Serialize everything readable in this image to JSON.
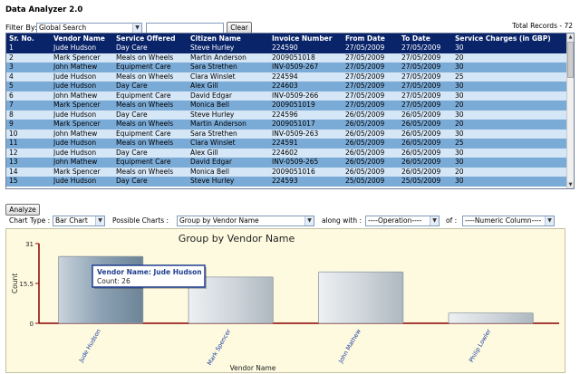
{
  "app": {
    "title": "Data Analyzer 2.0"
  },
  "filter": {
    "label": "Filter By:",
    "select_value": "Global Search",
    "search_value": "",
    "clear_label": "Clear",
    "total_records": "Total Records - 72"
  },
  "grid": {
    "columns": [
      "Sr. No.",
      "Vendor Name",
      "Service Offered",
      "Citizen Name",
      "Invoice Number",
      "From Date",
      "To Date",
      "Service Charges (in GBP)"
    ],
    "rows": [
      [
        "1",
        "Jude Hudson",
        "Day Care",
        "Steve Hurley",
        "224590",
        "27/05/2009",
        "27/05/2009",
        "30"
      ],
      [
        "2",
        "Mark Spencer",
        "Meals on Wheels",
        "Martin Anderson",
        "2009051018",
        "27/05/2009",
        "27/05/2009",
        "20"
      ],
      [
        "3",
        "John Mathew",
        "Equipment Care",
        "Sara Strethen",
        "INV-0509-267",
        "27/05/2009",
        "27/05/2009",
        "30"
      ],
      [
        "4",
        "Jude Hudson",
        "Meals on Wheels",
        "Clara Winslet",
        "224594",
        "27/05/2009",
        "27/05/2009",
        "25"
      ],
      [
        "5",
        "Jude Hudson",
        "Day Care",
        "Alex Gill",
        "224603",
        "27/05/2009",
        "27/05/2009",
        "30"
      ],
      [
        "6",
        "John Mathew",
        "Equipment Care",
        "David Edgar",
        "INV-0509-266",
        "27/05/2009",
        "27/05/2009",
        "30"
      ],
      [
        "7",
        "Mark Spencer",
        "Meals on Wheels",
        "Monica Bell",
        "2009051019",
        "27/05/2009",
        "27/05/2009",
        "20"
      ],
      [
        "8",
        "Jude Hudson",
        "Day Care",
        "Steve Hurley",
        "224596",
        "26/05/2009",
        "26/05/2009",
        "30"
      ],
      [
        "9",
        "Mark Spencer",
        "Meals on Wheels",
        "Martin Anderson",
        "2009051017",
        "26/05/2009",
        "26/05/2009",
        "20"
      ],
      [
        "10",
        "John Mathew",
        "Equipment Care",
        "Sara Strethen",
        "INV-0509-263",
        "26/05/2009",
        "26/05/2009",
        "30"
      ],
      [
        "11",
        "Jude Hudson",
        "Meals on Wheels",
        "Clara Winslet",
        "224591",
        "26/05/2009",
        "26/05/2009",
        "25"
      ],
      [
        "12",
        "Jude Hudson",
        "Day Care",
        "Alex Gill",
        "224602",
        "26/05/2009",
        "26/05/2009",
        "30"
      ],
      [
        "13",
        "John Mathew",
        "Equipment Care",
        "David Edgar",
        "INV-0509-265",
        "26/05/2009",
        "26/05/2009",
        "30"
      ],
      [
        "14",
        "Mark Spencer",
        "Meals on Wheels",
        "Monica Bell",
        "2009051016",
        "26/05/2009",
        "26/05/2009",
        "20"
      ],
      [
        "15",
        "Jude Hudson",
        "Day Care",
        "Steve Hurley",
        "224593",
        "25/05/2009",
        "25/05/2009",
        "30"
      ]
    ],
    "selected_row_index": 0
  },
  "analyze": {
    "button_label": "Analyze"
  },
  "chart_controls": {
    "chart_type_label": "Chart Type :",
    "chart_type_value": "Bar Chart",
    "possible_charts_label": "Possible Charts :",
    "possible_charts_value": "Group by Vendor Name",
    "along_with_label": "along with :",
    "operation_value": "----Operation----",
    "of_label": "of :",
    "numeric_column_value": "----Numeric Column----"
  },
  "tooltip": {
    "title": "Vendor Name: Jude Hudson",
    "value": "Count: 26"
  },
  "chart_data": {
    "type": "bar",
    "title": "Group by Vendor Name",
    "xlabel": "Vendor Name",
    "ylabel": "Count",
    "categories": [
      "Jude Hudson",
      "Mark Spencer",
      "John Mathew",
      "Philip Lowler"
    ],
    "values": [
      26,
      18,
      20,
      4
    ],
    "yticks": [
      "0",
      "15.5",
      "31"
    ],
    "ylim": [
      0,
      31
    ],
    "grid": false,
    "colors": {
      "bar": "#c8d0d8",
      "bar_highlight": "#7f96aa",
      "axis": "#8b0000",
      "panel": "#fdfae0",
      "tooltip_border": "#1f3e8f"
    }
  }
}
